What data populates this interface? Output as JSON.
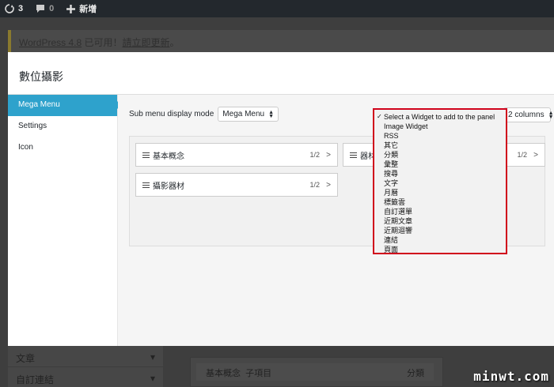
{
  "adminbar": {
    "updates_count": "3",
    "comments_count": "0",
    "new_label": "新增"
  },
  "background": {
    "notice_link": "WordPress 4.8",
    "notice_mid": " 已可用！",
    "notice_action": "請立即更新",
    "notice_tail": "。",
    "sidebar_items": [
      {
        "label": "文章",
        "chev": "▾"
      },
      {
        "label": "自訂連結",
        "chev": "▾"
      }
    ],
    "menu_item_label": "基本概念",
    "menu_item_sub": "子項目",
    "menu_item_type": "分類"
  },
  "modal": {
    "title": "數位攝影",
    "tabs": [
      {
        "label": "Mega Menu",
        "active": true
      },
      {
        "label": "Settings",
        "active": false
      },
      {
        "label": "Icon",
        "active": false
      }
    ],
    "submenu_mode_label": "Sub menu display mode",
    "submenu_mode_value": "Mega Menu",
    "columns_value": "2 columns",
    "panel_items": [
      {
        "label": "基本概念",
        "ratio": "1/2",
        "chev": ">"
      },
      {
        "label": "器材",
        "ratio": "1/2",
        "chev": ">"
      },
      {
        "label": "攝影器材",
        "ratio": "1/2",
        "chev": ">"
      }
    ]
  },
  "dropdown": {
    "options": [
      {
        "label": "Select a Widget to add to the panel",
        "selected": true
      },
      {
        "label": "Image Widget"
      },
      {
        "label": "RSS"
      },
      {
        "label": "其它"
      },
      {
        "label": "分類"
      },
      {
        "label": "彙整"
      },
      {
        "label": "搜尋"
      },
      {
        "label": "文字"
      },
      {
        "label": "月曆"
      },
      {
        "label": "標籤雲"
      },
      {
        "label": "自訂選單"
      },
      {
        "label": "近期文章"
      },
      {
        "label": "近期迴響"
      },
      {
        "label": "連結"
      },
      {
        "label": "頁面"
      }
    ],
    "highlight_color": "#d0021b"
  },
  "watermark": "minwt.com",
  "colors": {
    "accent": "#2ea2cc",
    "adminbar": "#23282d"
  }
}
